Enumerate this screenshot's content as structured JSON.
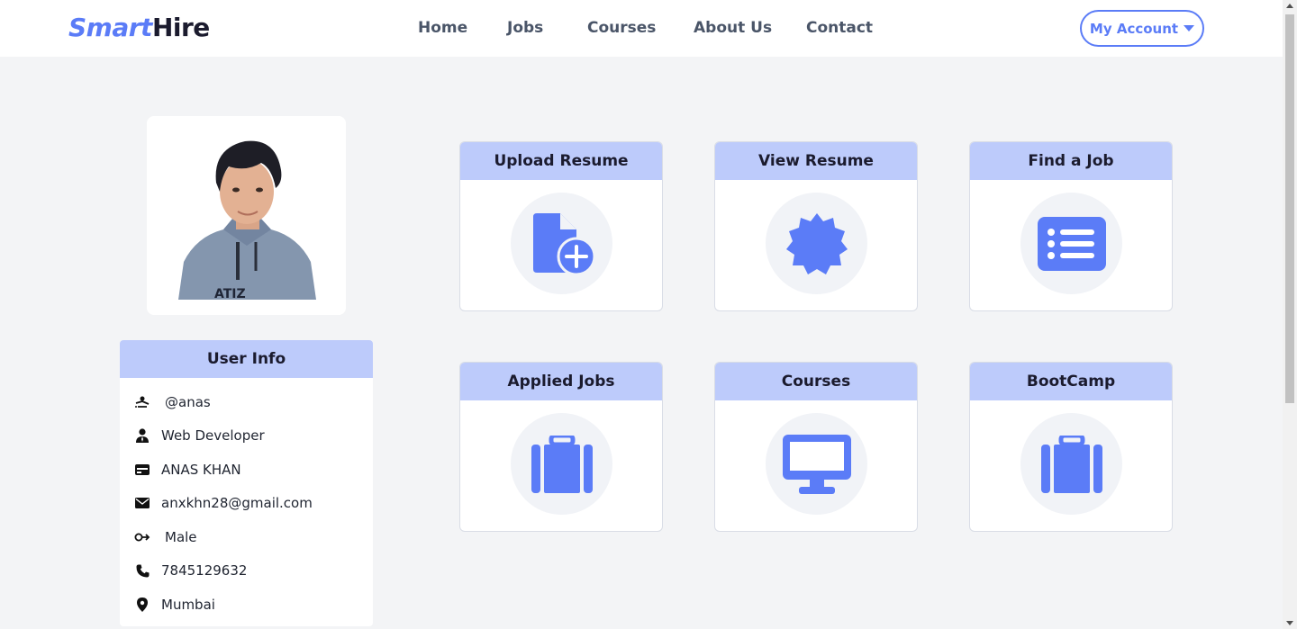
{
  "brand": {
    "part1": "Smart",
    "part2": "Hire"
  },
  "nav": [
    {
      "label": "Home"
    },
    {
      "label": "Jobs"
    },
    {
      "label": "Courses"
    },
    {
      "label": "About Us"
    },
    {
      "label": "Contact"
    }
  ],
  "account": {
    "label": "My Account",
    "icon": "caret-down-icon"
  },
  "colors": {
    "accent": "#5b7cf7",
    "header_band": "#bdcbfb",
    "background": "#f3f4f6"
  },
  "user_info": {
    "title": "User Info",
    "rows": [
      {
        "icon": "username-icon",
        "value": "@anas"
      },
      {
        "icon": "user-tie-icon",
        "value": "Web Developer"
      },
      {
        "icon": "id-card-icon",
        "value": "ANAS KHAN"
      },
      {
        "icon": "envelope-icon",
        "value": "anxkhn28@gmail.com"
      },
      {
        "icon": "gender-icon",
        "value": "Male"
      },
      {
        "icon": "phone-icon",
        "value": "7845129632"
      },
      {
        "icon": "location-pin-icon",
        "value": "Mumbai"
      }
    ]
  },
  "tiles": [
    {
      "title": "Upload Resume",
      "icon": "file-plus-icon"
    },
    {
      "title": "View Resume",
      "icon": "badge-icon"
    },
    {
      "title": "Find a Job",
      "icon": "list-icon"
    },
    {
      "title": "Applied Jobs",
      "icon": "suitcase-icon"
    },
    {
      "title": "Courses",
      "icon": "desktop-icon"
    },
    {
      "title": "BootCamp",
      "icon": "suitcase-icon"
    }
  ]
}
